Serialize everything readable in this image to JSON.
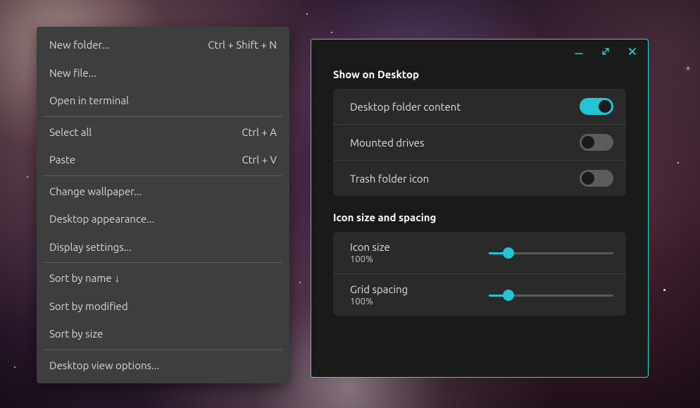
{
  "contextMenu": {
    "items": [
      {
        "label": "New folder...",
        "shortcut": "Ctrl + Shift + N"
      },
      {
        "label": "New file..."
      },
      {
        "label": "Open in terminal"
      },
      {
        "sep": true
      },
      {
        "label": "Select all",
        "shortcut": "Ctrl + A"
      },
      {
        "label": "Paste",
        "shortcut": "Ctrl + V"
      },
      {
        "sep": true
      },
      {
        "label": "Change wallpaper..."
      },
      {
        "label": "Desktop appearance..."
      },
      {
        "label": "Display settings..."
      },
      {
        "sep": true
      },
      {
        "label": "Sort by name",
        "arrow": true
      },
      {
        "label": "Sort by modified"
      },
      {
        "label": "Sort by size"
      },
      {
        "sep": true
      },
      {
        "label": "Desktop view options..."
      }
    ]
  },
  "window": {
    "titlebar": {
      "buttons": [
        "minimize-icon",
        "maximize-icon",
        "close-icon"
      ]
    },
    "section_show": {
      "title": "Show on Desktop",
      "rows": [
        {
          "label": "Desktop folder content",
          "on": true
        },
        {
          "label": "Mounted drives",
          "on": false
        },
        {
          "label": "Trash folder icon",
          "on": false
        }
      ]
    },
    "section_icon": {
      "title": "Icon size and spacing",
      "rows": [
        {
          "label": "Icon size",
          "value_text": "100%",
          "value_pct": 16
        },
        {
          "label": "Grid spacing",
          "value_text": "100%",
          "value_pct": 16
        }
      ]
    }
  },
  "colors": {
    "accent": "#22c5d6",
    "border": "#2ad4d4"
  }
}
